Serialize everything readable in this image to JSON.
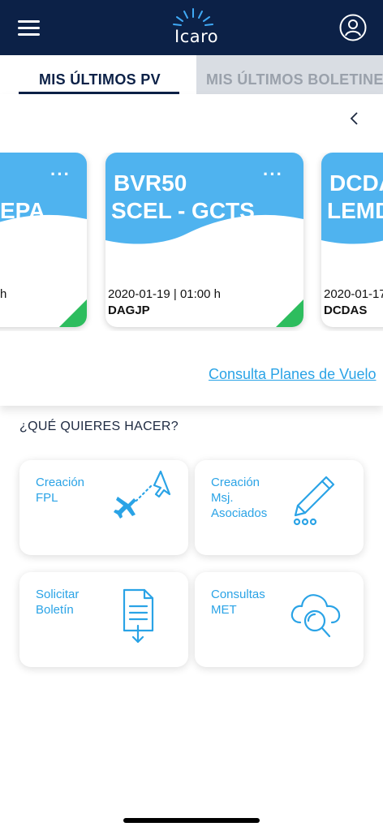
{
  "header": {
    "app_name": "Icaro",
    "menu_icon": "hamburger-menu-icon",
    "profile_icon": "user-profile-icon",
    "background_color": "#0c2147"
  },
  "tabs": [
    {
      "label": "MIS ÚLTIMOS PV",
      "active": true
    },
    {
      "label": "MIS ÚLTIMOS BOLETINES",
      "active": false
    }
  ],
  "flight_plans": {
    "back_icon": "chevron-left-icon",
    "cards": [
      {
        "line1": "",
        "line2": "EPA",
        "date": "h",
        "code": "",
        "status_color": "#2dbd5e"
      },
      {
        "line1": "BVR50",
        "line2": "SCEL - GCTS",
        "date": "2020-01-19 | 01:00 h",
        "code": "DAGJP",
        "status_color": "#2dbd5e"
      },
      {
        "line1": "DCDA",
        "line2": "LEMD",
        "date": "2020-01-17",
        "code": "DCDAS",
        "status_color": "#2dbd5e"
      }
    ],
    "more_label": "···",
    "consulta_link": "Consulta Planes de Vuelo"
  },
  "actions": {
    "question": "¿QUÉ QUIERES HACER?",
    "items": [
      {
        "label": "Creación\nFPL",
        "icon": "airplane-route-icon"
      },
      {
        "label": "Creación\nMsj.\nAsociados",
        "icon": "pencil-icon"
      },
      {
        "label": "Solicitar\nBoletín",
        "icon": "document-download-icon"
      },
      {
        "label": "Consultas\nMET",
        "icon": "cloud-search-icon"
      }
    ]
  },
  "colors": {
    "accent": "#2aa3e6",
    "card_blue": "#4fb3ef",
    "status_green": "#2dbd5e",
    "navy": "#0c2147"
  }
}
